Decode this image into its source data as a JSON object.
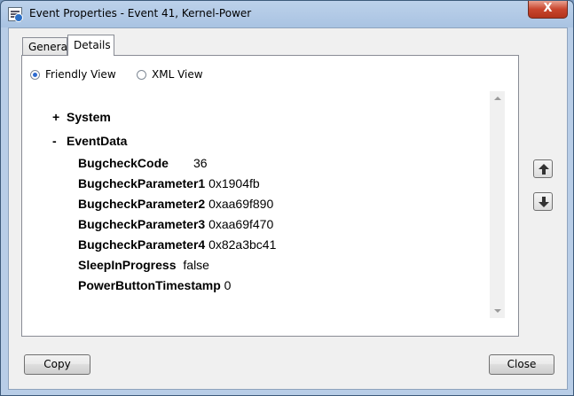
{
  "window": {
    "title": "Event Properties - Event 41, Kernel-Power",
    "close_glyph": "X"
  },
  "tabs": [
    {
      "label": "General",
      "active": false
    },
    {
      "label": "Details",
      "active": true
    }
  ],
  "view_options": {
    "friendly_label": "Friendly View",
    "xml_label": "XML View",
    "selected": "Friendly View"
  },
  "tree": {
    "system": {
      "toggle": "+",
      "label": "System"
    },
    "eventdata": {
      "toggle": "-",
      "label": "EventData"
    },
    "fields": [
      {
        "key": "BugcheckCode",
        "value": "36"
      },
      {
        "key": "BugcheckParameter1",
        "value": "0x1904fb"
      },
      {
        "key": "BugcheckParameter2",
        "value": "0xaa69f890"
      },
      {
        "key": "BugcheckParameter3",
        "value": "0xaa69f470"
      },
      {
        "key": "BugcheckParameter4",
        "value": "0x82a3bc41"
      },
      {
        "key": "SleepInProgress",
        "value": "false"
      },
      {
        "key": "PowerButtonTimestamp",
        "value": "0"
      }
    ]
  },
  "buttons": {
    "copy": "Copy",
    "close": "Close"
  },
  "icons": {
    "scroll_up": "arrow-up-icon",
    "scroll_down": "arrow-down-icon"
  }
}
